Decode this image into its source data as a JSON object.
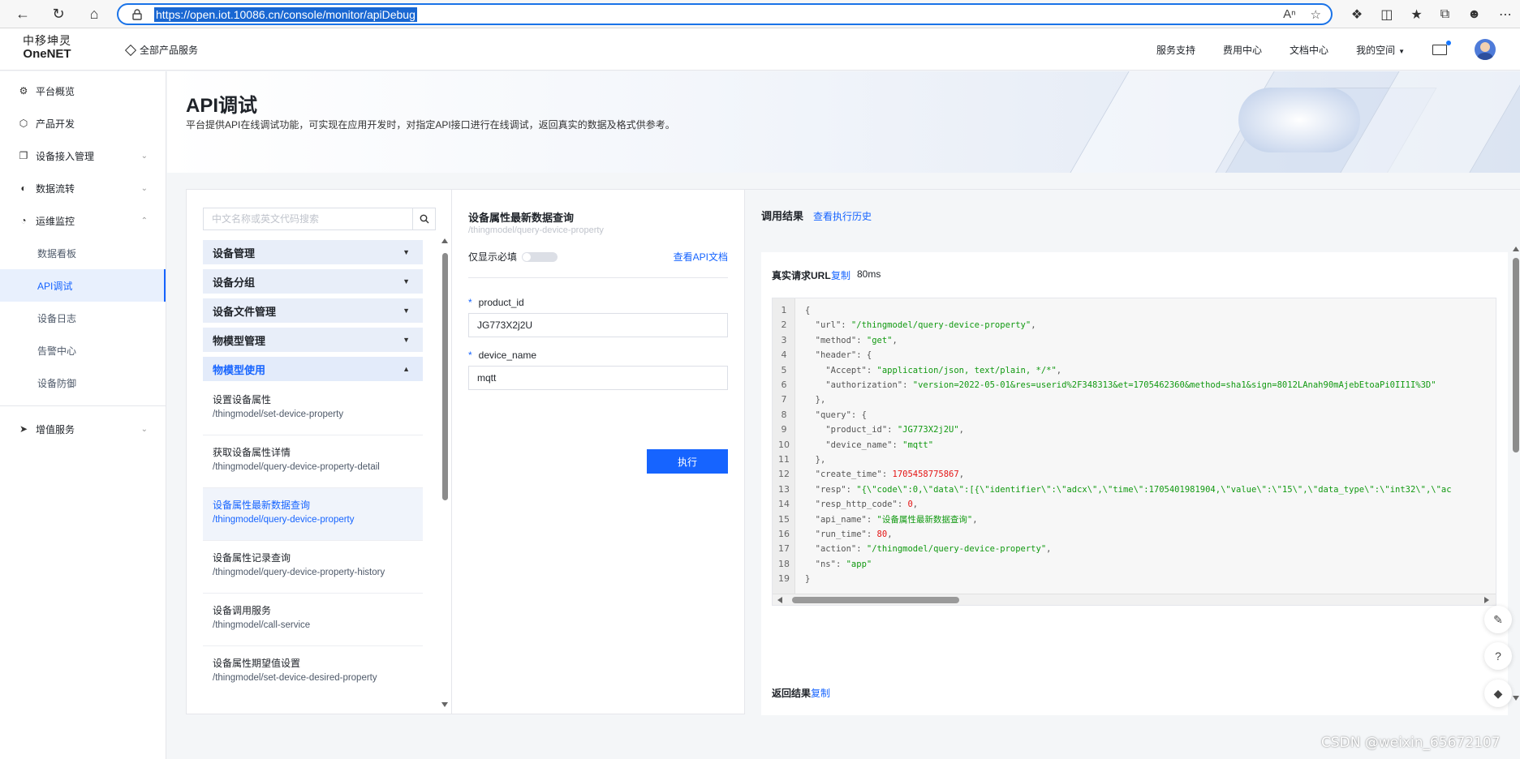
{
  "browser": {
    "url": "https://open.iot.10086.cn/console/monitor/apiDebug"
  },
  "header": {
    "logo_line1": "中移坤灵",
    "logo_line2": "OneNET",
    "all_products": "全部产品服务",
    "menu": [
      "服务支持",
      "费用中心",
      "文档中心",
      "我的空间"
    ]
  },
  "sidebar": {
    "items": [
      {
        "label": "平台概览",
        "icon": "dashboard-icon"
      },
      {
        "label": "产品开发",
        "icon": "cube-icon"
      },
      {
        "label": "设备接入管理",
        "icon": "devices-icon"
      },
      {
        "label": "数据流转",
        "icon": "flow-icon"
      },
      {
        "label": "运维监控",
        "icon": "monitor-icon"
      }
    ],
    "sub_items": [
      "数据看板",
      "API调试",
      "设备日志",
      "告警中心",
      "设备防御"
    ],
    "active_sub": "API调试",
    "extra": {
      "label": "增值服务",
      "icon": "rocket-icon"
    }
  },
  "banner": {
    "title": "API调试",
    "description": "平台提供API在线调试功能，可实现在应用开发时，对指定API接口进行在线调试，返回真实的数据及格式供参考。"
  },
  "api_list": {
    "search_placeholder": "中文名称或英文代码搜索",
    "groups": [
      "设备管理",
      "设备分组",
      "设备文件管理",
      "物模型管理",
      "物模型使用"
    ],
    "items": [
      {
        "name": "设置设备属性",
        "path": "/thingmodel/set-device-property"
      },
      {
        "name": "获取设备属性详情",
        "path": "/thingmodel/query-device-property-detail"
      },
      {
        "name": "设备属性最新数据查询",
        "path": "/thingmodel/query-device-property"
      },
      {
        "name": "设备属性记录查询",
        "path": "/thingmodel/query-device-property-history"
      },
      {
        "name": "设备调用服务",
        "path": "/thingmodel/call-service"
      },
      {
        "name": "设备属性期望值设置",
        "path": "/thingmodel/set-device-desired-property"
      }
    ]
  },
  "request": {
    "title": "设备属性最新数据查询",
    "path": "/thingmodel/query-device-property",
    "required_only_label": "仅显示必填",
    "doc_link": "查看API文档",
    "fields": [
      {
        "label": "product_id",
        "value": "JG773X2j2U"
      },
      {
        "label": "device_name",
        "value": "mqtt"
      }
    ],
    "execute_label": "执行"
  },
  "result": {
    "title": "调用结果",
    "history_link": "查看执行历史",
    "url_label": "真实请求URL",
    "copy_label": "复制",
    "duration": "80ms",
    "return_label": "返回结果",
    "code_lines": [
      [
        [
          "p",
          "{"
        ]
      ],
      [
        [
          "p",
          "  "
        ],
        [
          "k",
          "\"url\""
        ],
        [
          "p",
          ": "
        ],
        [
          "s",
          "\"/thingmodel/query-device-property\""
        ],
        [
          "p",
          ","
        ]
      ],
      [
        [
          "p",
          "  "
        ],
        [
          "k",
          "\"method\""
        ],
        [
          "p",
          ": "
        ],
        [
          "s",
          "\"get\""
        ],
        [
          "p",
          ","
        ]
      ],
      [
        [
          "p",
          "  "
        ],
        [
          "k",
          "\"header\""
        ],
        [
          "p",
          ": {"
        ]
      ],
      [
        [
          "p",
          "    "
        ],
        [
          "k",
          "\"Accept\""
        ],
        [
          "p",
          ": "
        ],
        [
          "s",
          "\"application/json, text/plain, */*\""
        ],
        [
          "p",
          ","
        ]
      ],
      [
        [
          "p",
          "    "
        ],
        [
          "k",
          "\"authorization\""
        ],
        [
          "p",
          ": "
        ],
        [
          "s",
          "\"version=2022-05-01&res=userid%2F348313&et=1705462360&method=sha1&sign=8012LAnah90mAjebEtoaPi0II1I%3D\""
        ]
      ],
      [
        [
          "p",
          "  },"
        ]
      ],
      [
        [
          "p",
          "  "
        ],
        [
          "k",
          "\"query\""
        ],
        [
          "p",
          ": {"
        ]
      ],
      [
        [
          "p",
          "    "
        ],
        [
          "k",
          "\"product_id\""
        ],
        [
          "p",
          ": "
        ],
        [
          "s",
          "\"JG773X2j2U\""
        ],
        [
          "p",
          ","
        ]
      ],
      [
        [
          "p",
          "    "
        ],
        [
          "k",
          "\"device_name\""
        ],
        [
          "p",
          ": "
        ],
        [
          "s",
          "\"mqtt\""
        ]
      ],
      [
        [
          "p",
          "  },"
        ]
      ],
      [
        [
          "p",
          "  "
        ],
        [
          "k",
          "\"create_time\""
        ],
        [
          "p",
          ": "
        ],
        [
          "n",
          "1705458775867"
        ],
        [
          "p",
          ","
        ]
      ],
      [
        [
          "p",
          "  "
        ],
        [
          "k",
          "\"resp\""
        ],
        [
          "p",
          ": "
        ],
        [
          "s",
          "\"{\\\"code\\\":0,\\\"data\\\":[{\\\"identifier\\\":\\\"adcx\\\",\\\"time\\\":1705401981904,\\\"value\\\":\\\"15\\\",\\\"data_type\\\":\\\"int32\\\",\\\"ac"
        ]
      ],
      [
        [
          "p",
          "  "
        ],
        [
          "k",
          "\"resp_http_code\""
        ],
        [
          "p",
          ": "
        ],
        [
          "n",
          "0"
        ],
        [
          "p",
          ","
        ]
      ],
      [
        [
          "p",
          "  "
        ],
        [
          "k",
          "\"api_name\""
        ],
        [
          "p",
          ": "
        ],
        [
          "s",
          "\"设备属性最新数据查询\""
        ],
        [
          "p",
          ","
        ]
      ],
      [
        [
          "p",
          "  "
        ],
        [
          "k",
          "\"run_time\""
        ],
        [
          "p",
          ": "
        ],
        [
          "n",
          "80"
        ],
        [
          "p",
          ","
        ]
      ],
      [
        [
          "p",
          "  "
        ],
        [
          "k",
          "\"action\""
        ],
        [
          "p",
          ": "
        ],
        [
          "s",
          "\"/thingmodel/query-device-property\""
        ],
        [
          "p",
          ","
        ]
      ],
      [
        [
          "p",
          "  "
        ],
        [
          "k",
          "\"ns\""
        ],
        [
          "p",
          ": "
        ],
        [
          "s",
          "\"app\""
        ]
      ],
      [
        [
          "p",
          "}"
        ]
      ]
    ]
  },
  "watermark": "CSDN @weixin_65672107"
}
